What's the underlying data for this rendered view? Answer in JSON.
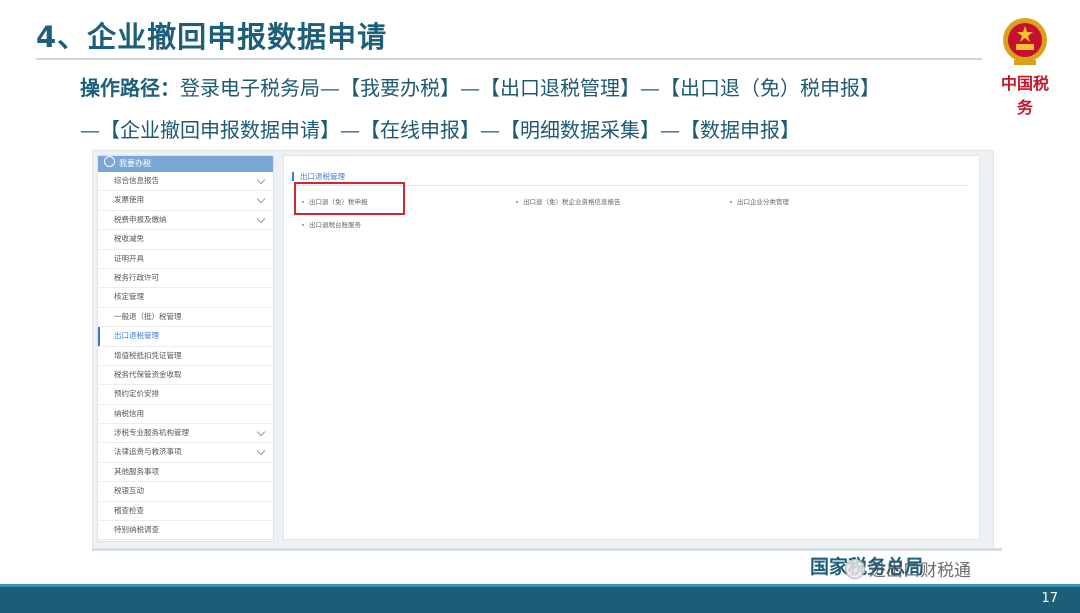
{
  "slide": {
    "title": "4、企业撤回申报数据申请",
    "logo_text": "中国税务",
    "path_label": "操作路径：",
    "path_line1": "登录电子税务局—【我要办税】—【出口退税管理】—【出口退（免）税申报】",
    "path_line2": "—【企业撤回申报数据申请】—【在线申报】—【明细数据采集】—【数据申报】",
    "footer": "国家税务总局",
    "watermark": "进出口财税通",
    "page_number": "17"
  },
  "sidebar": {
    "header": "我要办税",
    "items": [
      {
        "label": "综合信息报告",
        "expandable": true
      },
      {
        "label": "发票使用",
        "expandable": true
      },
      {
        "label": "税费申报及缴纳",
        "expandable": true
      },
      {
        "label": "税收减免",
        "expandable": false
      },
      {
        "label": "证明开具",
        "expandable": false
      },
      {
        "label": "税务行政许可",
        "expandable": false
      },
      {
        "label": "核定管理",
        "expandable": false
      },
      {
        "label": "一般退（抵）税管理",
        "expandable": false
      },
      {
        "label": "出口退税管理",
        "expandable": false,
        "active": true
      },
      {
        "label": "增值税抵扣凭证管理",
        "expandable": false
      },
      {
        "label": "税务代保管资金收取",
        "expandable": false
      },
      {
        "label": "预约定价安排",
        "expandable": false
      },
      {
        "label": "纳税信用",
        "expandable": false
      },
      {
        "label": "涉税专业服务机构管理",
        "expandable": true
      },
      {
        "label": "法律追责与救济事项",
        "expandable": true
      },
      {
        "label": "其他服务事项",
        "expandable": false
      },
      {
        "label": "税银互动",
        "expandable": false
      },
      {
        "label": "稽查检查",
        "expandable": false
      },
      {
        "label": "特别纳税调查",
        "expandable": false
      }
    ]
  },
  "panel": {
    "title": "出口退税管理",
    "links": [
      {
        "label": "出口退（免）税申报",
        "highlighted": true
      },
      {
        "label": "出口退（免）税企业资格信息报告"
      },
      {
        "label": "出口企业分类管理"
      },
      {
        "label": "出口退税台账服务"
      }
    ]
  },
  "colors": {
    "title": "#1d5f7a",
    "accent": "#3a7bd5",
    "highlight_border": "#d62828",
    "bottom_bar": "#1c5d78"
  }
}
